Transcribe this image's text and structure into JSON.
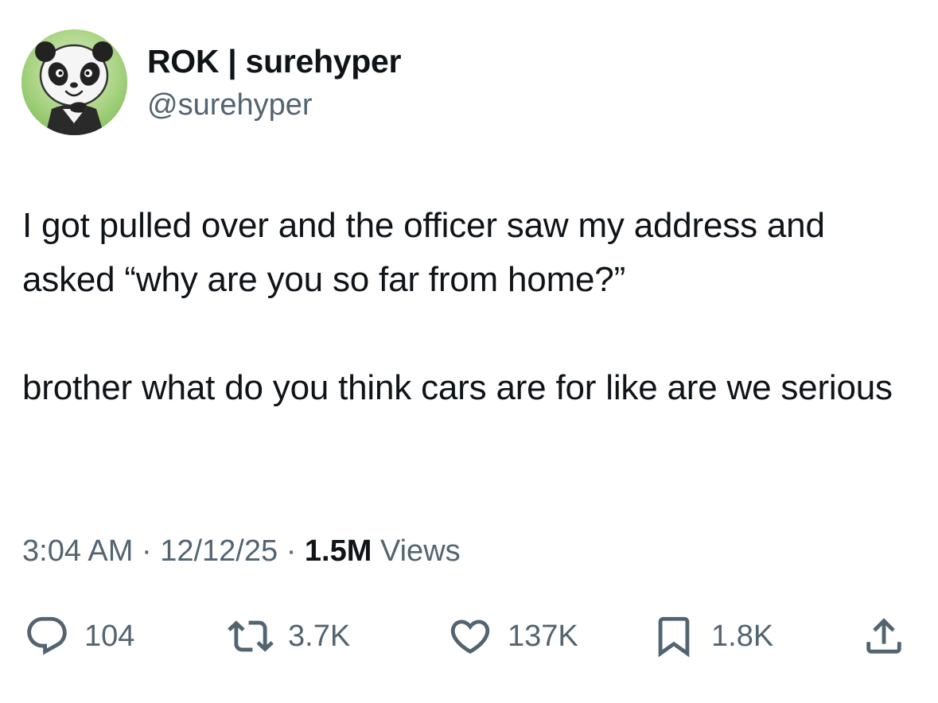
{
  "author": {
    "display_name": "ROK | surehyper",
    "handle": "@surehyper",
    "avatar_icon": "panda-avatar-icon"
  },
  "tweet": {
    "paragraphs": [
      "I got pulled over and the officer saw my address and asked “why are you so far from home?”",
      "brother what do you think cars are for like are we serious"
    ],
    "time": "3:04 AM",
    "date": "12/12/25",
    "views_count": "1.5M",
    "views_label": "Views",
    "separator": "·"
  },
  "actions": {
    "replies": "104",
    "retweets": "3.7K",
    "likes": "137K",
    "bookmarks": "1.8K"
  },
  "colors": {
    "text_primary": "#0f1419",
    "text_secondary": "#536471",
    "avatar_bg": "#8fc46a"
  }
}
